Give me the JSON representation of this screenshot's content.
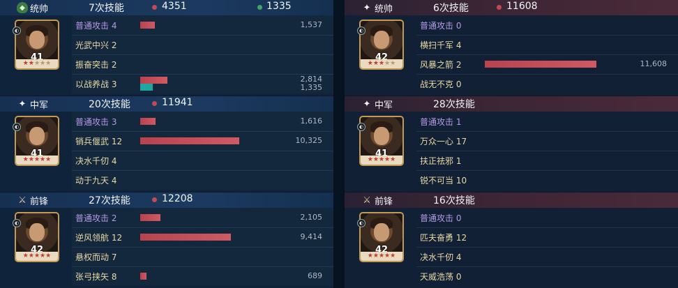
{
  "colors": {
    "damage_bar": "#c44a52",
    "heal_bar": "#1ea7a2",
    "normal_attack_text": "#b49ae6",
    "skill_text": "#e8d9a6"
  },
  "teams": [
    {
      "side": "left",
      "units": [
        {
          "role_icon": "shield-icon",
          "role": "统帅",
          "skill_count": "7次技能",
          "damage_total": "4351",
          "heal_total": "1335",
          "level": "41",
          "stars": 5,
          "stars_on": 2,
          "skills": [
            {
              "name": "普通攻击",
              "count": "4",
              "normal": true,
              "damage": 1537,
              "damage_text": "1,537"
            },
            {
              "name": "光武中兴",
              "count": "2"
            },
            {
              "name": "振奋突击",
              "count": "2"
            },
            {
              "name": "以战养战",
              "count": "3",
              "damage": 2814,
              "damage_text": "2,814",
              "heal": 1335,
              "heal_text": "1,335"
            }
          ]
        },
        {
          "role_icon": "sparkle-icon",
          "role": "中军",
          "skill_count": "20次技能",
          "damage_total": "11941",
          "level": "41",
          "stars": 5,
          "stars_on": 5,
          "skills": [
            {
              "name": "普通攻击",
              "count": "3",
              "normal": true,
              "damage": 1616,
              "damage_text": "1,616"
            },
            {
              "name": "销兵偃武",
              "count": "12",
              "damage": 10325,
              "damage_text": "10,325"
            },
            {
              "name": "决水千仞",
              "count": "4"
            },
            {
              "name": "动于九天",
              "count": "4"
            }
          ]
        },
        {
          "role_icon": "sword-icon",
          "role": "前锋",
          "skill_count": "27次技能",
          "damage_total": "12208",
          "level": "42",
          "stars": 5,
          "stars_on": 5,
          "skills": [
            {
              "name": "普通攻击",
              "count": "2",
              "normal": true,
              "damage": 2105,
              "damage_text": "2,105"
            },
            {
              "name": "逆风领航",
              "count": "12",
              "damage": 9414,
              "damage_text": "9,414"
            },
            {
              "name": "悬权而动",
              "count": "7"
            },
            {
              "name": "张弓挟矢",
              "count": "8",
              "damage": 689,
              "damage_text": "689"
            }
          ]
        }
      ]
    },
    {
      "side": "right",
      "units": [
        {
          "role_icon": "sparkle-icon",
          "role": "统帅",
          "skill_count": "6次技能",
          "damage_total": "11608",
          "level": "42",
          "stars": 5,
          "stars_on": 3,
          "skills": [
            {
              "name": "普通攻击",
              "count": "0",
              "normal": true
            },
            {
              "name": "横扫千军",
              "count": "4"
            },
            {
              "name": "风暴之箭",
              "count": "2",
              "damage": 11608,
              "damage_text": "11,608"
            },
            {
              "name": "战无不克",
              "count": "0"
            }
          ]
        },
        {
          "role_icon": "sparkle-icon",
          "role": "中军",
          "skill_count": "28次技能",
          "level": "41",
          "stars": 5,
          "stars_on": 5,
          "skills": [
            {
              "name": "普通攻击",
              "count": "1",
              "normal": true
            },
            {
              "name": "万众一心",
              "count": "17"
            },
            {
              "name": "扶正祛邪",
              "count": "1"
            },
            {
              "name": "锐不可当",
              "count": "10"
            }
          ]
        },
        {
          "role_icon": "sword-icon",
          "role": "前锋",
          "skill_count": "16次技能",
          "level": "42",
          "stars": 5,
          "stars_on": 5,
          "skills": [
            {
              "name": "普通攻击",
              "count": "0",
              "normal": true
            },
            {
              "name": "匹夫奋勇",
              "count": "12"
            },
            {
              "name": "决水千仞",
              "count": "4"
            },
            {
              "name": "天威浩荡",
              "count": "0"
            }
          ]
        }
      ]
    }
  ]
}
